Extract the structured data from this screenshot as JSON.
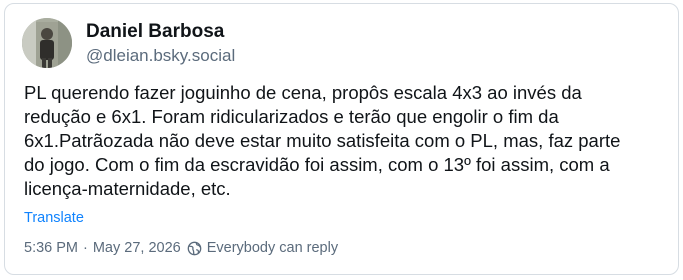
{
  "post": {
    "author": {
      "display_name": "Daniel Barbosa",
      "handle": "@dleian.bsky.social"
    },
    "lines": [
      "PL querendo fazer joguinho de cena, propôs escala 4x3 ao invés da",
      "redução e 6x1. Foram ridicularizados e terão que engolir o fim da",
      "6x1.Patrãozada não deve estar muito satisfeita com o PL, mas, faz parte",
      "do jogo. Com o fim da escravidão foi assim, com o 13º foi assim, com a",
      "licença-maternidade, etc."
    ],
    "translate_label": "Translate",
    "timestamp": "5:36 PM",
    "separator": "·",
    "date": "May 27, 2026",
    "reply_setting": "Everybody can reply",
    "icons": {
      "reply_setting": "globe-icon"
    },
    "colors": {
      "text": "#101418",
      "muted": "#5b6b7c",
      "link": "#1083fe",
      "border": "#d7dde3"
    }
  }
}
